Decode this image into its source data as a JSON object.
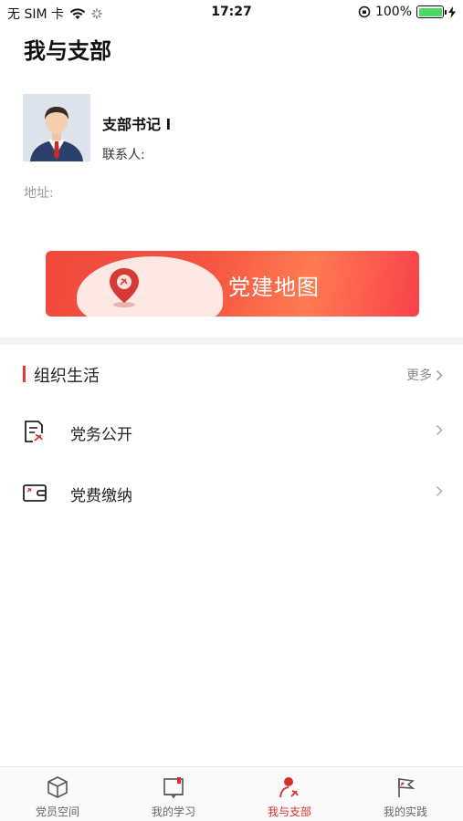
{
  "status_bar": {
    "carrier": "无 SIM 卡",
    "time": "17:27",
    "battery_percent": "100%",
    "battery_level": 1.0
  },
  "page": {
    "title": "我与支部"
  },
  "profile": {
    "name": "支部书记 l",
    "contact_label": "联系人:",
    "address_label": "地址:"
  },
  "banner": {
    "label": "党建地图"
  },
  "section": {
    "title": "组织生活",
    "more_label": "更多"
  },
  "list": [
    {
      "label": "党务公开",
      "icon": "document-party-icon"
    },
    {
      "label": "党费缴纳",
      "icon": "wallet-icon"
    }
  ],
  "tabbar": {
    "tabs": [
      {
        "label": "党员空间",
        "icon": "cube-icon",
        "active": false
      },
      {
        "label": "我的学习",
        "icon": "book-icon",
        "active": false
      },
      {
        "label": "我与支部",
        "icon": "person-party-icon",
        "active": true
      },
      {
        "label": "我的实践",
        "icon": "flag-icon",
        "active": false
      }
    ]
  },
  "colors": {
    "accent": "#e53a2f",
    "battery": "#4cd964",
    "active_tab": "#d6322b"
  }
}
